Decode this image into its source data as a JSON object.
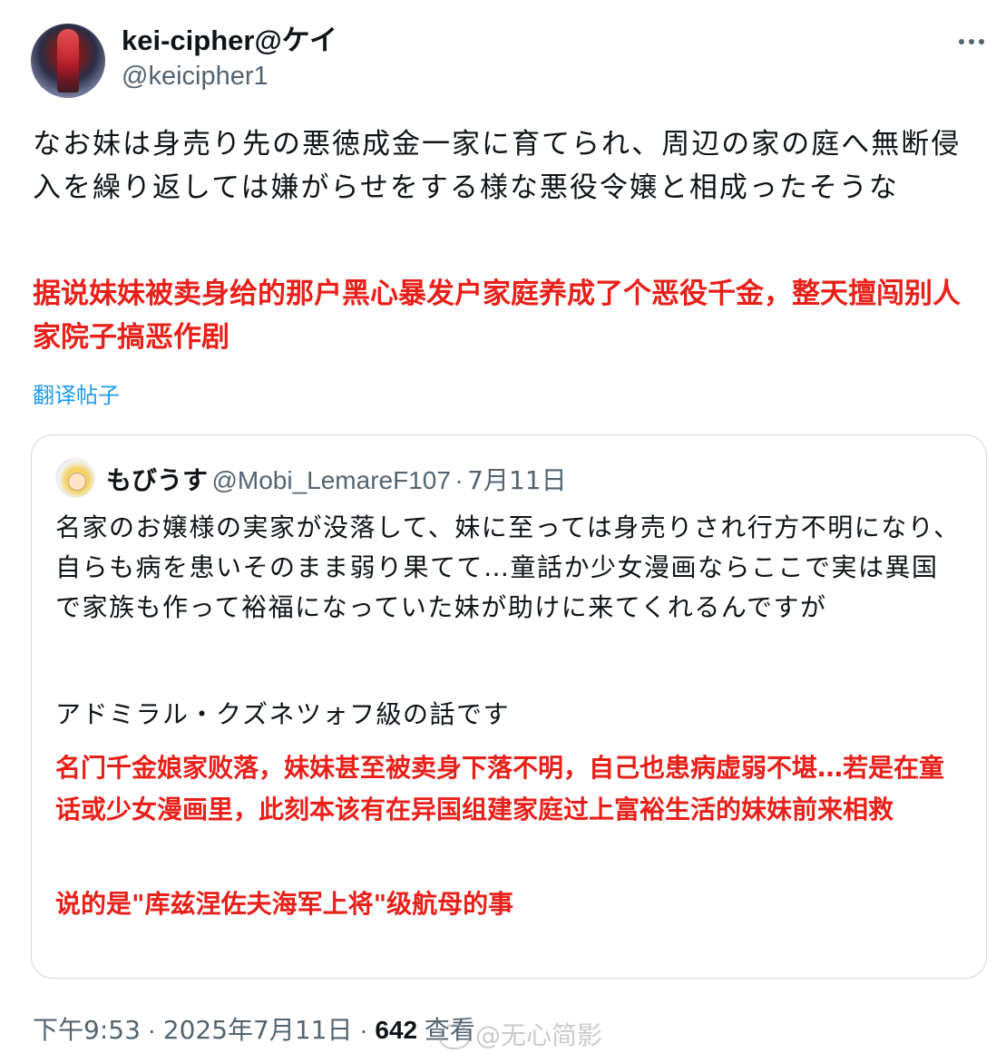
{
  "author": {
    "name": "kei-cipher@ケイ",
    "handle": "@keicipher1"
  },
  "tweet": {
    "text": "なお妹は身売り先の悪徳成金一家に育てられ、周辺の家の庭へ無断侵入を繰り返しては嫌がらせをする様な悪役令嬢と相成ったそうな",
    "translation_overlay": "据说妹妹被卖身给的那户黑心暴发户家庭养成了个恶役千金，整天擅闯别人家院子搞恶作剧",
    "translate_link": "翻译帖子"
  },
  "quote": {
    "name": "もびうす",
    "handle": "@Mobi_LemareF107",
    "separator": "·",
    "date": "7月11日",
    "text": "名家のお嬢様の実家が没落して、妹に至っては身売りされ行方不明になり、自らも病を患いそのまま弱り果てて…童話か少女漫画ならここで実は異国で家族も作って裕福になっていた妹が助けに来てくれるんですが",
    "text_2": "アドミラル・クズネツォフ級の話です",
    "translation_overlay": "名门千金娘家败落，妹妹甚至被卖身下落不明，自己也患病虚弱不堪…若是在童话或少女漫画里，此刻本该有在异国组建家庭过上富裕生活的妹妹前来相救",
    "translation_overlay_2": "说的是\"库兹涅佐夫海军上将\"级航母的事"
  },
  "meta": {
    "time": "下午9:53",
    "sep1": "·",
    "date": "2025年7月11日",
    "sep2": "·",
    "views_count": "642",
    "views_label": "查看"
  },
  "watermark": {
    "text": "@无心简影"
  },
  "icons": {
    "more": "more-horizontal-icon"
  },
  "colors": {
    "text": "#0f1419",
    "secondary": "#536471",
    "link": "#1d9bf0",
    "overlay_red": "#e8201a",
    "border": "#cfd9de"
  }
}
